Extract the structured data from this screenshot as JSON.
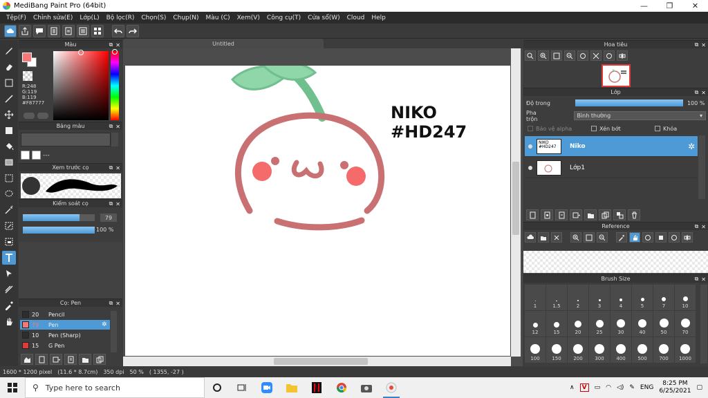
{
  "window": {
    "title": "MediBang Paint Pro (64bit)",
    "minimize_glyph": "—",
    "maximize_glyph": "❐",
    "close_glyph": "✕"
  },
  "menu": [
    "Tệp(F)",
    "Chỉnh sửa(E)",
    "Lớp(L)",
    "Bộ lọc(R)",
    "Chọn(S)",
    "Chụp(N)",
    "Màu (C)",
    "Xem(V)",
    "Công cụ(T)",
    "Cửa sổ(W)",
    "Cloud",
    "Help"
  ],
  "panels": {
    "color": {
      "title": "Màu",
      "r": "R:248",
      "g": "G:119",
      "b": "B:119",
      "hex": "#F87777",
      "fg_color": "#f87777"
    },
    "palette": {
      "title": "Bảng màu",
      "dash": "---"
    },
    "brush_preview": {
      "title": "Xem trước cọ"
    },
    "brush_control": {
      "title": "Kiểm soát cọ",
      "size": "79",
      "opacity": "100 %",
      "size_fraction": 0.79,
      "opacity_fraction": 1.0
    },
    "brush_list": {
      "title": "Cọ: Pen",
      "items": [
        {
          "size": "20",
          "name": "Pencil",
          "color": "#2e2e2e"
        },
        {
          "size": "79",
          "name": "Pen",
          "color": "#f87777"
        },
        {
          "size": "10",
          "name": "Pen (Sharp)",
          "color": "#2e2e2e"
        },
        {
          "size": "15",
          "name": "G Pen",
          "color": "#e03a3a"
        }
      ]
    }
  },
  "canvas": {
    "tab": "Untitled",
    "art_text_1": "NIKO",
    "art_text_2": "#HD247"
  },
  "status": {
    "dimensions": "1600 * 1200 pixel",
    "physical": "(11.6 * 8.7cm)",
    "dpi": "350 dpi",
    "zoom": "50 %",
    "cursor": "( 1355, -27 )"
  },
  "right": {
    "navigator": {
      "title": "Hoa tiêu"
    },
    "layers": {
      "title": "Lớp",
      "opacity_label": "Độ trong",
      "opacity_value": "100 %",
      "blend_label": "Pha trộn",
      "blend_value": "Bình thường",
      "protect_alpha": "Bảo vệ alpha",
      "clipping": "Xén bớt",
      "lock": "Khóa",
      "items": [
        {
          "name": "Niko",
          "thumb": "NIKO #HD247"
        },
        {
          "name": "Lớp1",
          "thumb": ""
        }
      ]
    },
    "reference": {
      "title": "Reference"
    },
    "brush_size": {
      "title": "Brush Size",
      "sizes": [
        "1",
        "1.5",
        "2",
        "3",
        "4",
        "5",
        "7",
        "10",
        "12",
        "15",
        "20",
        "25",
        "30",
        "40",
        "50",
        "70",
        "100",
        "150",
        "200",
        "300",
        "400",
        "500",
        "700",
        "1000"
      ]
    }
  },
  "taskbar": {
    "search_placeholder": "Type here to search",
    "lang": "ENG",
    "time": "8:25 PM",
    "date": "6/25/2021"
  },
  "colors": {
    "accent": "#4e9ad6",
    "face_stroke": "#c97172",
    "cheek": "#f56b6b",
    "leaf": "#8fd6a8",
    "leaf_stroke": "#6fbf8f"
  }
}
